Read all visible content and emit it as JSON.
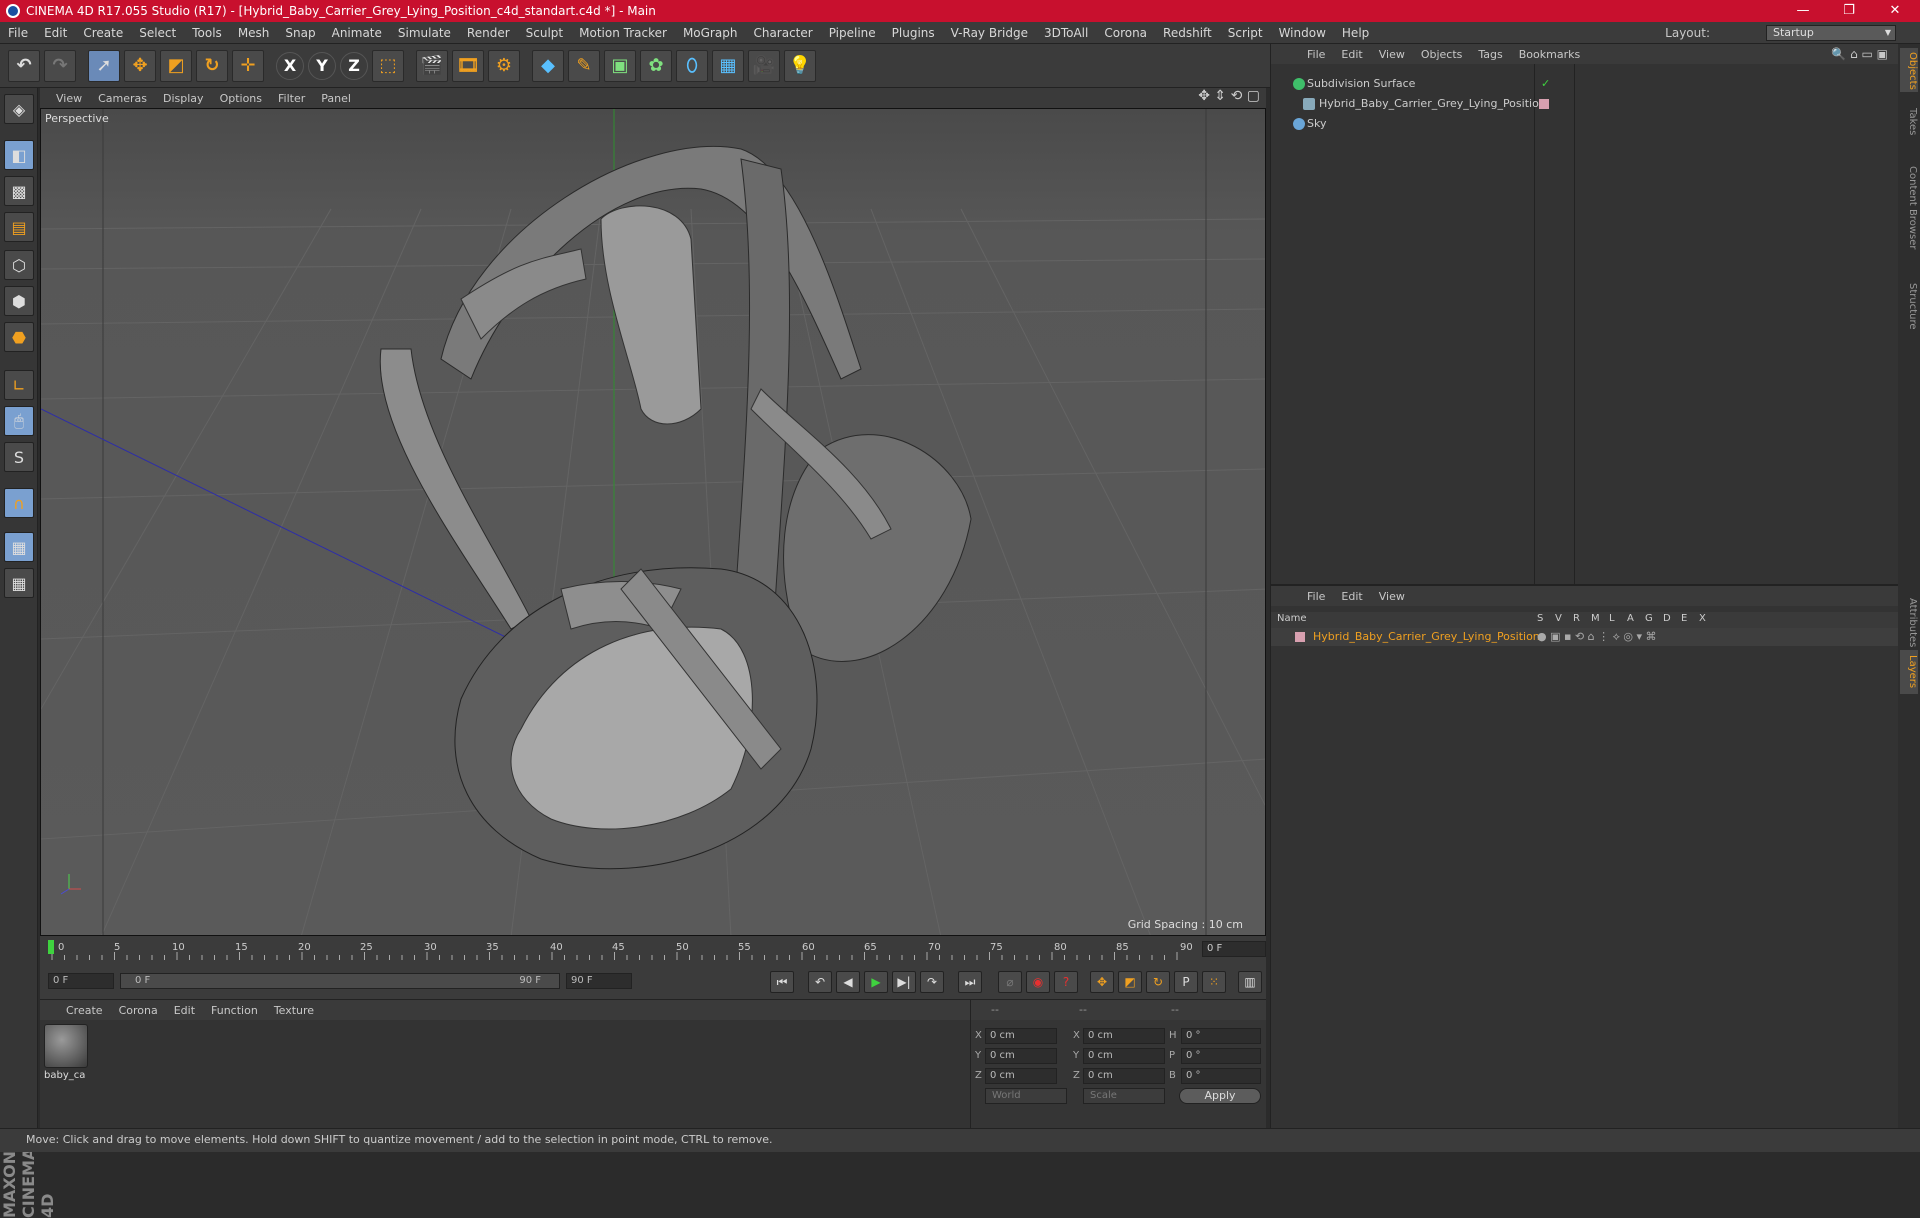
{
  "window": {
    "title": "CINEMA 4D R17.055 Studio (R17) - [Hybrid_Baby_Carrier_Grey_Lying_Position_c4d_standart.c4d *] - Main",
    "minimize": "—",
    "maximize": "❐",
    "close": "✕"
  },
  "menu": [
    "File",
    "Edit",
    "Create",
    "Select",
    "Tools",
    "Mesh",
    "Snap",
    "Animate",
    "Simulate",
    "Render",
    "Sculpt",
    "Motion Tracker",
    "MoGraph",
    "Character",
    "Pipeline",
    "Plugins",
    "V-Ray Bridge",
    "3DToAll",
    "Corona",
    "Redshift",
    "Script",
    "Window",
    "Help"
  ],
  "layout": {
    "label": "Layout:",
    "value": "Startup"
  },
  "toolbar": {
    "x_axis": "X",
    "y_axis": "Y",
    "z_axis": "Z"
  },
  "viewport": {
    "menu": [
      "View",
      "Cameras",
      "Display",
      "Options",
      "Filter",
      "Panel"
    ],
    "label": "Perspective",
    "grid_spacing": "Grid Spacing : 10 cm"
  },
  "timeline": {
    "ticks": [
      "0",
      "5",
      "10",
      "15",
      "20",
      "25",
      "30",
      "35",
      "40",
      "45",
      "50",
      "55",
      "60",
      "65",
      "70",
      "75",
      "80",
      "85",
      "90"
    ],
    "current_frame": "0 F"
  },
  "transport": {
    "start_field": "0 F",
    "range_start": "0 F",
    "range_end": "90 F",
    "end_field": "90 F"
  },
  "material_manager": {
    "menu": [
      "Create",
      "Corona",
      "Edit",
      "Function",
      "Texture"
    ],
    "material_name": "baby_ca"
  },
  "coordinates": {
    "header": [
      "--",
      "--",
      "--"
    ],
    "rows": [
      {
        "a": "X",
        "av": "0 cm",
        "b": "X",
        "bv": "0 cm",
        "c": "H",
        "cv": "0 °"
      },
      {
        "a": "Y",
        "av": "0 cm",
        "b": "Y",
        "bv": "0 cm",
        "c": "P",
        "cv": "0 °"
      },
      {
        "a": "Z",
        "av": "0 cm",
        "b": "Z",
        "bv": "0 cm",
        "c": "B",
        "cv": "0 °"
      }
    ],
    "mode1": "World",
    "mode2": "Scale",
    "apply": "Apply"
  },
  "object_manager": {
    "menu": [
      "File",
      "Edit",
      "View",
      "Objects",
      "Tags",
      "Bookmarks"
    ],
    "objects": [
      "Subdivision Surface",
      "Hybrid_Baby_Carrier_Grey_Lying_Position",
      "Sky"
    ]
  },
  "layer_manager": {
    "menu": [
      "File",
      "Edit",
      "View"
    ],
    "columns": [
      "Name",
      "S",
      "V",
      "R",
      "M",
      "L",
      "A",
      "G",
      "D",
      "E",
      "X"
    ],
    "layer": "Hybrid_Baby_Carrier_Grey_Lying_Position"
  },
  "right_tabs": [
    "Objects",
    "Takes",
    "Content Browser",
    "Structure",
    "Attributes",
    "Layers"
  ],
  "status": "Move: Click and drag to move elements. Hold down SHIFT to quantize movement / add to the selection in point mode, CTRL to remove.",
  "branding": "MAXON CINEMA 4D",
  "colors": {
    "title_bar": "#c8102e",
    "accent": "#f0a020",
    "viewport": "#555555"
  }
}
